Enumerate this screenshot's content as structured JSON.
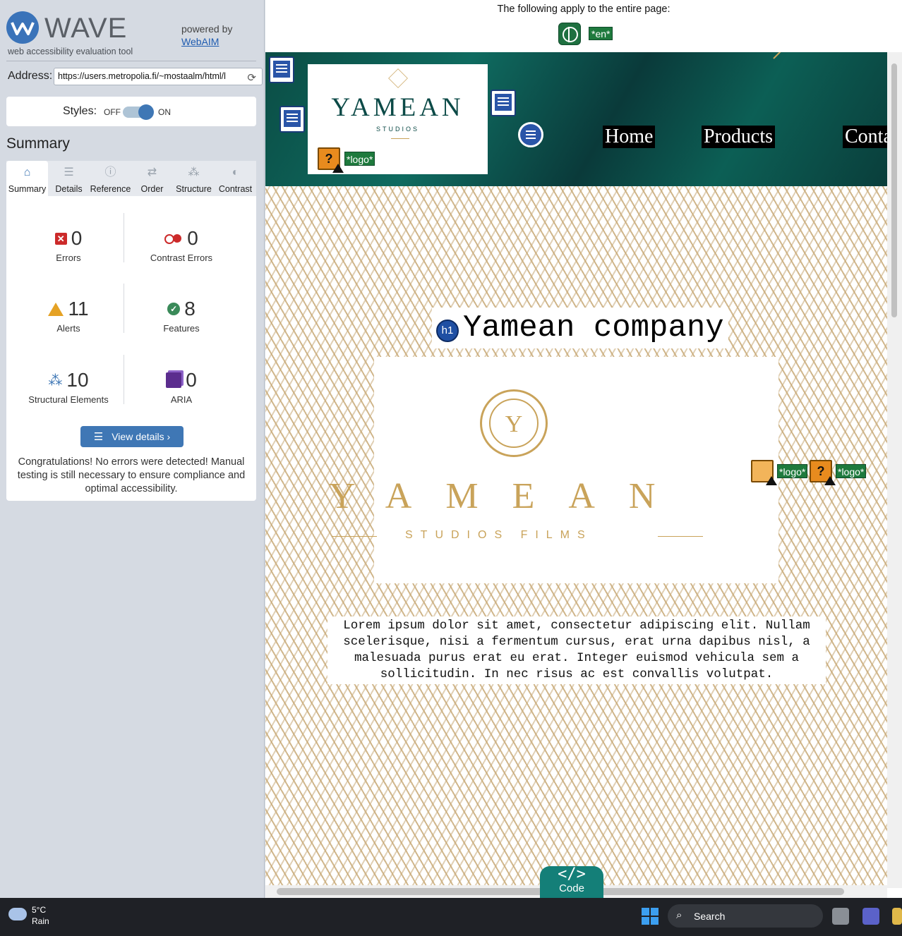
{
  "wave": {
    "title": "WAVE",
    "subtitle": "web accessibility evaluation tool",
    "powered_by": "powered by",
    "webaim": "WebAIM",
    "address_label": "Address:",
    "address_value": "https://users.metropolia.fi/~mostaalm/html/l",
    "styles_label": "Styles:",
    "styles_off": "OFF",
    "styles_on": "ON",
    "styles_enabled": true,
    "summary_heading": "Summary",
    "tabs": [
      {
        "label": "Summary",
        "icon": "home-icon",
        "active": true
      },
      {
        "label": "Details",
        "icon": "list-icon",
        "active": false
      },
      {
        "label": "Reference",
        "icon": "info-icon",
        "active": false
      },
      {
        "label": "Order",
        "icon": "order-icon",
        "active": false
      },
      {
        "label": "Structure",
        "icon": "structure-icon",
        "active": false
      },
      {
        "label": "Contrast",
        "icon": "contrast-icon",
        "active": false
      }
    ],
    "stats": {
      "errors": {
        "value": "0",
        "label": "Errors"
      },
      "contrast_errors": {
        "value": "0",
        "label": "Contrast Errors"
      },
      "alerts": {
        "value": "11",
        "label": "Alerts"
      },
      "features": {
        "value": "8",
        "label": "Features"
      },
      "structural": {
        "value": "10",
        "label": "Structural Elements"
      },
      "aria": {
        "value": "0",
        "label": "ARIA"
      }
    },
    "view_details": "View details ›",
    "congrats": "Congratulations! No errors were detected! Manual testing is still necessary to ensure compliance and optimal accessibility."
  },
  "page": {
    "apply_text": "The following apply to the entire page:",
    "lang_badge": "*en*",
    "logo_title": "YAMEAN",
    "logo_sub": "STUDIOS",
    "logo_alt_badge": "*logo*",
    "nav": [
      "Home",
      "Products",
      "Conta"
    ],
    "h1_badge": "h1",
    "h1": "Yamean company",
    "hero_emblem_letter": "Y",
    "hero_title": "YAMEAN",
    "hero_sub": "STUDIOS FILMS",
    "hero_alt_badges": [
      "*logo*",
      "*logo*"
    ],
    "lorem": "Lorem ipsum dolor sit amet, consectetur adipiscing elit. Nullam scelerisque, nisi a fermentum cursus, erat urna dapibus nisl, a malesuada purus erat eu erat. Integer euismod vehicula sem a sollicitudin. In nec risus ac est convallis volutpat.",
    "code_icon": "</>",
    "code_label": "Code"
  },
  "taskbar": {
    "temp": "5°C",
    "condition": "Rain",
    "search": "Search"
  },
  "colors": {
    "wave_blue": "#3f77b5",
    "error_red": "#cc2a2a",
    "alert_orange": "#e5a224",
    "feature_green": "#3a8a59",
    "aria_purple": "#5b2d8e",
    "badge_green": "#1e7a3d",
    "gold": "#c9a35a",
    "header_teal": "#0f6b60"
  }
}
